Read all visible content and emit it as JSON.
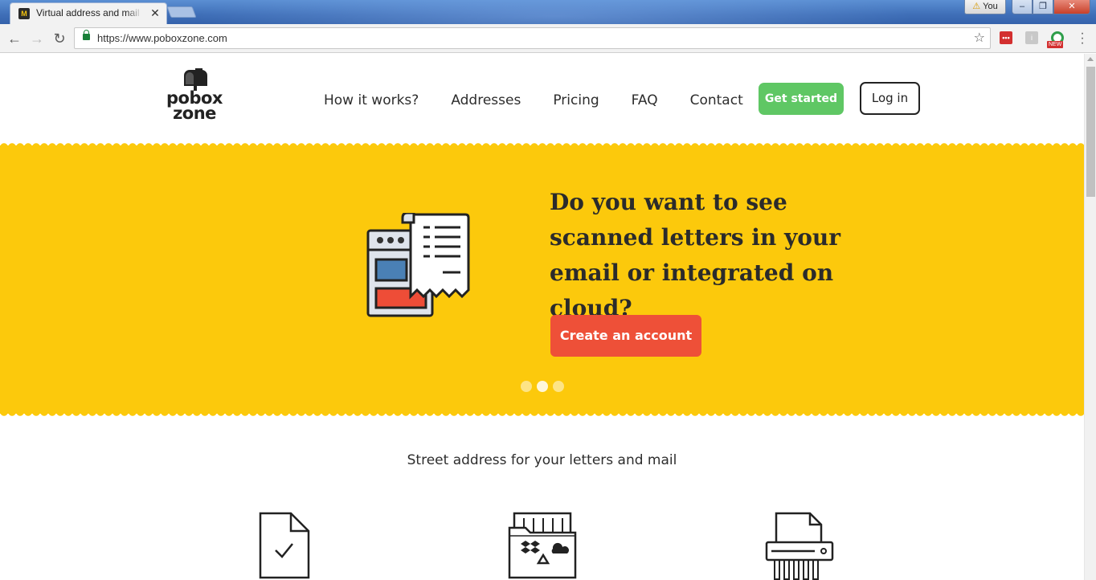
{
  "browser": {
    "tab_title": "Virtual address and mail",
    "tab_close": "✕",
    "profile_label": "You",
    "url": "https://www.poboxzone.com",
    "ext_new_badge": "NEW",
    "win_min": "–",
    "win_max": "❐",
    "win_close": "✕"
  },
  "header": {
    "logo_line1": "pobox",
    "logo_line2": "zone",
    "nav": [
      "How it works?",
      "Addresses",
      "Pricing",
      "FAQ",
      "Contact"
    ],
    "get_started": "Get started",
    "login": "Log in"
  },
  "hero": {
    "title": "Do you want to see scanned letters in your email or integrated on cloud?",
    "cta": "Create an account",
    "slides_total": 3,
    "active_slide": 2
  },
  "features": {
    "subtitle": "Street address for your letters and mail",
    "icons": [
      "document-check-icon",
      "cloud-folder-icon",
      "shredder-icon"
    ]
  },
  "colors": {
    "hero_bg": "#fcc90c",
    "get_started_bg": "#5fc764",
    "cta_bg": "#ee5038"
  }
}
